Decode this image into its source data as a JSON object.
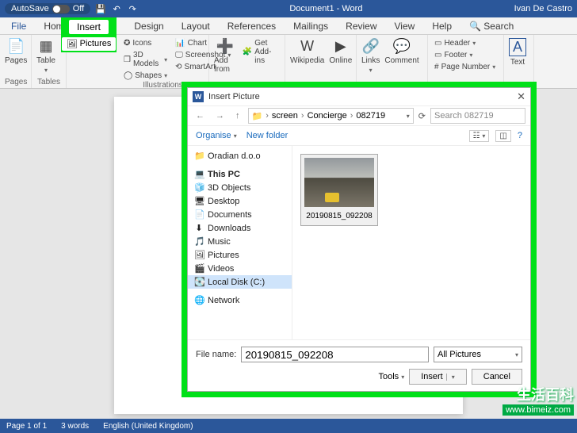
{
  "titlebar": {
    "autosave_label": "AutoSave",
    "autosave_state": "Off",
    "doc_title": "Document1 - Word",
    "user": "Ivan De Castro"
  },
  "tabs": {
    "file": "File",
    "home": "Home",
    "insert": "Insert",
    "design": "Design",
    "layout": "Layout",
    "references": "References",
    "mailings": "Mailings",
    "review": "Review",
    "view": "View",
    "help": "Help",
    "search": "Search"
  },
  "highlight": {
    "tab": "Insert",
    "button": "Pictures"
  },
  "ribbon": {
    "pages": {
      "label": "Pages",
      "btn": "Pages"
    },
    "tables": {
      "label": "Tables",
      "btn": "Table"
    },
    "illustrations": {
      "label": "Illustrations",
      "icons": "Icons",
      "models": "3D Models",
      "shapes": "Shapes",
      "smartart": "SmartArt",
      "chart": "Chart",
      "screenshot": "Screenshot"
    },
    "addins": {
      "add_from": "Add from",
      "get": "Get Add-ins"
    },
    "media": {
      "wikipedia": "Wikipedia",
      "online": "Online"
    },
    "links": {
      "links": "Links",
      "comment": "Comment"
    },
    "header": {
      "header": "Header",
      "footer": "Footer",
      "page_num": "Page Number"
    },
    "text": {
      "textbox": "Text"
    }
  },
  "dialog": {
    "title": "Insert Picture",
    "breadcrumb": [
      "screen",
      "Concierge",
      "082719"
    ],
    "search_placeholder": "Search 082719",
    "organise": "Organise",
    "new_folder": "New folder",
    "nav": {
      "oradian": "Oradian d.o.o",
      "this_pc": "This PC",
      "objects3d": "3D Objects",
      "desktop": "Desktop",
      "documents": "Documents",
      "downloads": "Downloads",
      "music": "Music",
      "pictures": "Pictures",
      "videos": "Videos",
      "local_disk": "Local Disk (C:)",
      "network": "Network"
    },
    "thumb_caption": "20190815_092208",
    "filename_label": "File name:",
    "filename_value": "20190815_092208",
    "filter": "All Pictures",
    "tools": "Tools",
    "insert": "Insert",
    "cancel": "Cancel"
  },
  "status": {
    "page": "Page 1 of 1",
    "words": "3 words",
    "lang": "English (United Kingdom)"
  },
  "watermark": {
    "cn": "生活百科",
    "url": "www.bimeiz.com"
  }
}
